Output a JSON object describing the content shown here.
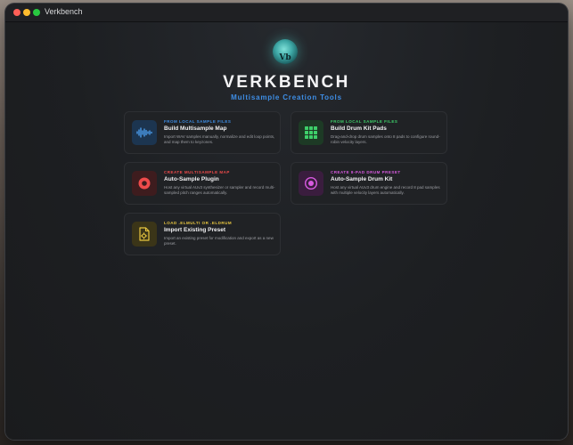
{
  "window": {
    "title": "Verkbench"
  },
  "header": {
    "logo_text": "Vb",
    "title": "VERKBENCH",
    "subtitle": "Multisample Creation Tools"
  },
  "colors": {
    "accent_blue": "#3e8ee6",
    "accent_green": "#3ecf6a",
    "accent_red": "#ef4b4b",
    "accent_magenta": "#d85ae0",
    "accent_yellow": "#e8c640"
  },
  "cards": [
    {
      "eyebrow": "FROM LOCAL SAMPLE FILES",
      "title": "Build Multisample Map",
      "description": "Import WAV samples manually, normalize and edit loop points, and map them to keyzones.",
      "icon": "waveform-icon"
    },
    {
      "eyebrow": "FROM LOCAL SAMPLE FILES",
      "title": "Build Drum Kit Pads",
      "description": "Drag-and-drop drum samples onto 8 pads to configure round-robin velocity layers.",
      "icon": "pad-grid-icon"
    },
    {
      "eyebrow": "CREATE MULTISAMPLE MAP",
      "title": "Auto-Sample Plugin",
      "description": "Host any virtual AUv3 synthesizer or sampler and record multi-sampled pitch ranges automatically.",
      "icon": "record-icon"
    },
    {
      "eyebrow": "CREATE 8-PAD DRUM PRESET",
      "title": "Auto-Sample Drum Kit",
      "description": "Host any virtual AUv3 drum engine and record 8 pad samples with multiple velocity layers automatically.",
      "icon": "record-ring-icon"
    },
    {
      "eyebrow": "LOAD .ELMULTI OR .ELDRUM",
      "title": "Import Existing Preset",
      "description": "Import an existing preset for modification and export as a new preset.",
      "icon": "document-gear-icon"
    }
  ]
}
